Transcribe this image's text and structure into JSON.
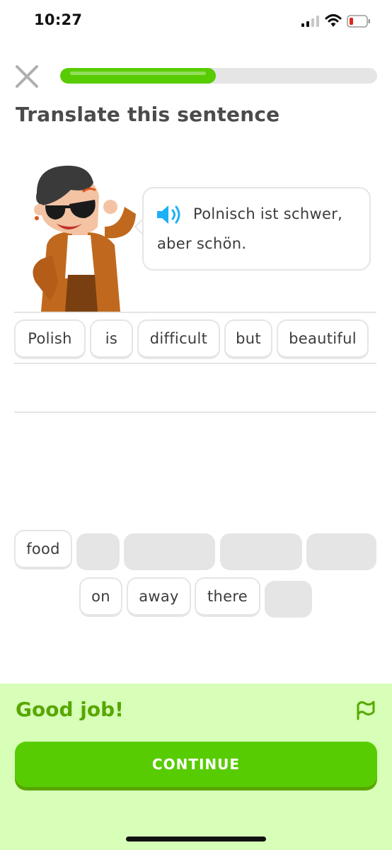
{
  "status_bar": {
    "time": "10:27"
  },
  "header": {
    "progress": 0.49
  },
  "page_title": "Translate this sentence",
  "prompt": {
    "line1": "Polnisch ist schwer,",
    "line2": "aber schön."
  },
  "answer_words": [
    {
      "label": "Polish"
    },
    {
      "label": "is"
    },
    {
      "label": "difficult"
    },
    {
      "label": "but"
    },
    {
      "label": "beautiful"
    }
  ],
  "bank_words": [
    {
      "label": "food"
    },
    {
      "label": "on"
    },
    {
      "label": "away"
    },
    {
      "label": "there"
    }
  ],
  "feedback": {
    "title": "Good job!",
    "button_label": "CONTINUE"
  },
  "colors": {
    "accent": "#58cc02",
    "accent_dark": "#58a700",
    "feedback_bg": "#d7ffb8",
    "speaker": "#1cb0f6",
    "border": "#e5e5e5"
  },
  "icons": [
    "close-icon",
    "speaker-icon",
    "flag-icon",
    "signal-icon",
    "wifi-icon",
    "battery-icon"
  ]
}
